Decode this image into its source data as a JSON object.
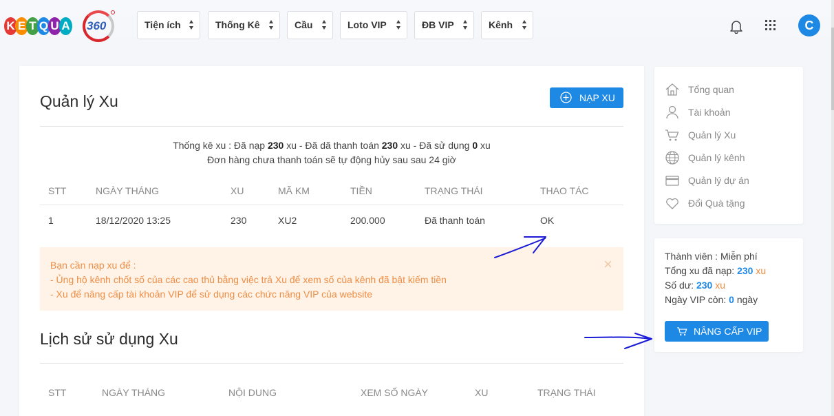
{
  "logo": {
    "text": "KETQUA",
    "suffix": "360",
    "letter_colors": [
      "#e53935",
      "#fb8c00",
      "#43a047",
      "#1e88e5",
      "#8e24aa",
      "#00acc1"
    ]
  },
  "nav": [
    {
      "label": "Tiện ích"
    },
    {
      "label": "Thống Kê"
    },
    {
      "label": "Cầu"
    },
    {
      "label": "Loto VIP"
    },
    {
      "label": "ĐB VIP"
    },
    {
      "label": "Kênh"
    }
  ],
  "header": {
    "avatar_letter": "C"
  },
  "main": {
    "title": "Quản lý Xu",
    "nap_button": "NẠP XU",
    "stats": {
      "prefix": "Thống kê xu : Đã nạp ",
      "deposited": "230",
      "mid1": " xu - Đã dã thanh toán ",
      "paid": "230",
      "mid2": " xu - Đã sử dụng ",
      "used": "0",
      "suffix": " xu"
    },
    "notice_line": "Đơn hàng chưa thanh toán sẽ tự động hủy sau sau 24 giờ",
    "table": {
      "headers": [
        "STT",
        "NGÀY THÁNG",
        "XU",
        "MÃ KM",
        "TIỀN",
        "TRẠNG THÁI",
        "THAO TÁC"
      ],
      "rows": [
        {
          "stt": "1",
          "date": "18/12/2020 13:25",
          "xu": "230",
          "code": "XU2",
          "amount": "200.000",
          "status": "Đã thanh toán",
          "action": "OK"
        }
      ]
    },
    "alert": {
      "line1": "Bạn cần nạp xu để :",
      "line2": "- Ủng hộ kênh chốt số của các cao thủ bằng việc trả Xu để xem số của kênh đã bật kiếm tiền",
      "line3": "- Xu để nâng cấp tài khoản VIP để sử dụng các chức năng VIP của website",
      "close": "×"
    },
    "history_title": "Lịch sử sử dụng Xu",
    "history_headers": [
      "STT",
      "NGÀY THÁNG",
      "NỘI DUNG",
      "XEM SỐ NGÀY",
      "XU",
      "TRẠNG THÁI"
    ]
  },
  "sidebar": {
    "menu": [
      {
        "label": "Tổng quan",
        "icon": "home-icon"
      },
      {
        "label": "Tài khoản",
        "icon": "user-icon"
      },
      {
        "label": "Quản lý Xu",
        "icon": "cart-icon"
      },
      {
        "label": "Quản lý kênh",
        "icon": "globe-icon"
      },
      {
        "label": "Quản lý dự án",
        "icon": "card-icon"
      },
      {
        "label": "Đổi Quà tặng",
        "icon": "heart-icon"
      }
    ],
    "member": {
      "member_label": "Thành viên : ",
      "member_value": "Miễn phí",
      "total_label": "Tổng xu đã nạp: ",
      "total_value": "230",
      "total_unit": " xu",
      "balance_label": "Số dư: ",
      "balance_value": "230",
      "balance_unit": " xu",
      "vip_label": "Ngày VIP còn: ",
      "vip_value": "0",
      "vip_unit": " ngày",
      "upgrade_button": "NÂNG CẤP VIP"
    }
  },
  "colors": {
    "accent": "#1e88e5",
    "notice_bg": "#fff2e6",
    "notice_text": "#ef8e45",
    "annotation": "#1a1ad6"
  }
}
